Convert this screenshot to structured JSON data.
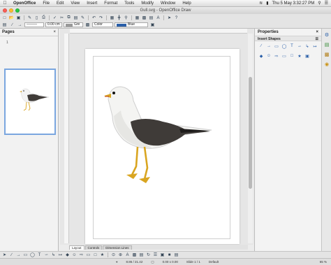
{
  "menubar": {
    "app": "OpenOffice",
    "items": [
      "File",
      "Edit",
      "View",
      "Insert",
      "Format",
      "Tools",
      "Modify",
      "Window",
      "Help"
    ],
    "clock": "Thu 5 May  3:32:27 PM"
  },
  "window": {
    "title": "Gull.svg - OpenOffice Draw"
  },
  "toolbar2": {
    "line_width": "0.00 cm",
    "line_style": "Gre",
    "area_style": "Color",
    "color": "Blue"
  },
  "pages": {
    "title": "Pages",
    "number": "1"
  },
  "tabs": [
    "Layout",
    "Controls",
    "Dimension Lines"
  ],
  "properties": {
    "title": "Properties",
    "section": "Insert Shapes"
  },
  "status": {
    "position": "8.86 / 21.42",
    "size": "0.00 x 0.00",
    "page": "Slide 1 / 1",
    "layout": "Default",
    "zoom": "65 %"
  },
  "colors": {
    "selection": "#7aa6df",
    "gull_wing": "#3f3b38",
    "gull_leg": "#d9a520",
    "red": "#ff5f57",
    "yellow": "#ffbd2e",
    "green": "#28c940"
  }
}
